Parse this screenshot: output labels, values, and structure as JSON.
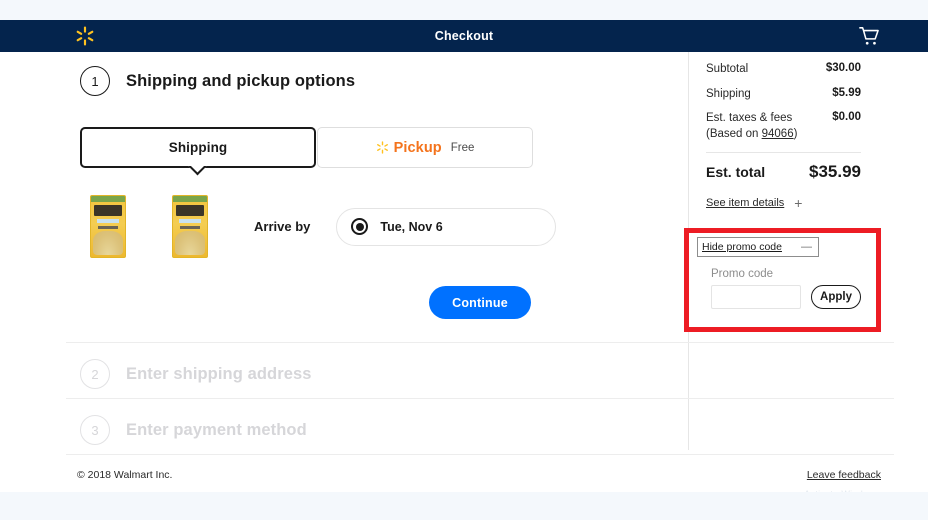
{
  "header": {
    "logo_icon": "walmart-spark-icon",
    "title": "Checkout",
    "cart_icon": "shopping-cart-icon",
    "bg_color": "#04244d",
    "spark_color": "#ffc220"
  },
  "steps": [
    {
      "number": "1",
      "title": "Shipping and pickup options",
      "state": "active"
    },
    {
      "number": "2",
      "title": "Enter shipping address",
      "state": "disabled"
    },
    {
      "number": "3",
      "title": "Enter payment method",
      "state": "disabled"
    }
  ],
  "fulfillment": {
    "shipping_tab": {
      "label": "Shipping",
      "selected": true
    },
    "pickup_tab": {
      "label": "Pickup",
      "sub_label": "Free",
      "selected": false,
      "icon": "spark-icon",
      "color": "#f4731c"
    }
  },
  "shipment": {
    "arrive_label": "Arrive by",
    "delivery_date": "Tue, Nov 6",
    "selected": true,
    "item_count": 2
  },
  "continue_button": {
    "label": "Continue",
    "color": "#0071ff"
  },
  "summary": {
    "rows": [
      {
        "label": "Subtotal",
        "value": "$30.00"
      },
      {
        "label": "Shipping",
        "value": "$5.99"
      }
    ],
    "taxes": {
      "label": "Est. taxes & fees",
      "based_on_prefix": "(Based on ",
      "zip": "94066",
      "based_on_suffix": ")",
      "value": "$0.00"
    },
    "total": {
      "label": "Est. total",
      "value": "$35.99"
    },
    "item_details": {
      "label": "See item details",
      "icon": "plus-icon",
      "glyph": "+"
    }
  },
  "promo": {
    "toggle_label": "Hide promo code",
    "toggle_glyph": "—",
    "field_label": "Promo code",
    "input_value": "",
    "input_placeholder": "",
    "apply_label": "Apply",
    "highlight_color": "#ed1c24"
  },
  "footer": {
    "copyright": "© 2018 Walmart Inc.",
    "feedback": "Leave feedback",
    "watermark": "Activate Windows"
  }
}
